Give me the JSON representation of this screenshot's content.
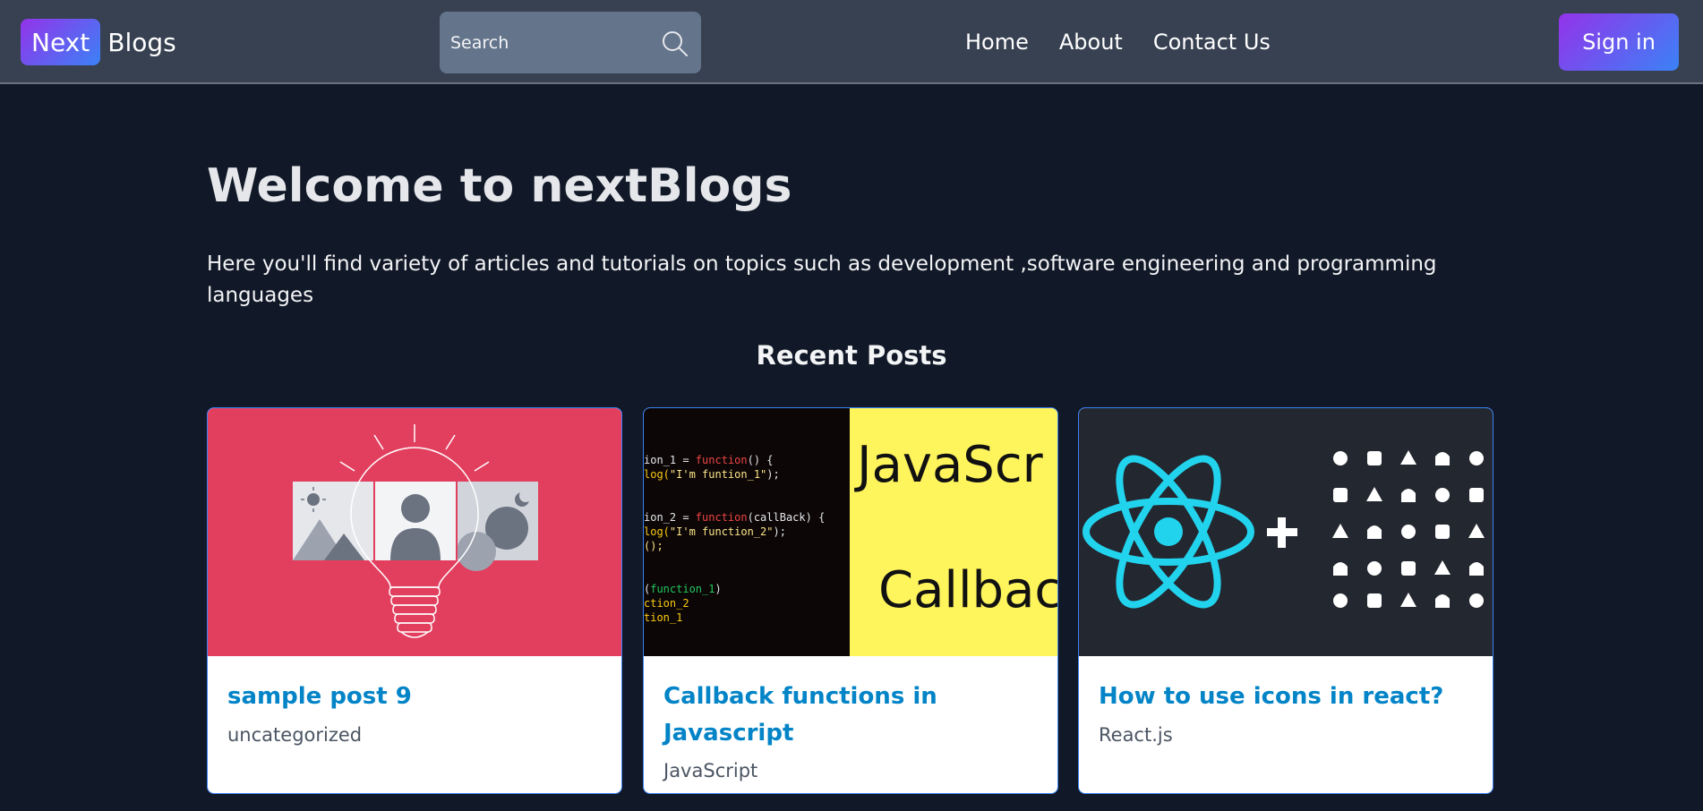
{
  "navbar": {
    "brand_badge": "Next",
    "brand_text": "Blogs",
    "search": {
      "placeholder": "Search",
      "value": ""
    },
    "links": [
      "Home",
      "About",
      "Contact Us"
    ],
    "signin_label": "Sign in"
  },
  "hero": {
    "title": "Welcome to nextBlogs",
    "description": "Here you'll find variety of articles and tutorials on topics such as development ,software engineering and programming languages"
  },
  "recent": {
    "heading": "Recent Posts",
    "posts": [
      {
        "title": "sample post 9",
        "category": "uncategorized",
        "image_icon": "lightbulb-illustration"
      },
      {
        "title": "Callback functions in Javascript",
        "category": "JavaScript",
        "image_icon": "javascript-code-illustration"
      },
      {
        "title": "How to use icons in react?",
        "category": "React.js",
        "image_icon": "react-icons-illustration"
      }
    ]
  },
  "code_image": {
    "lines": [
      [
        {
          "t": "ion_1 = ",
          "c": "#e5e7eb"
        },
        {
          "t": "function",
          "c": "#ef4444"
        },
        {
          "t": "() {",
          "c": "#e5e7eb"
        }
      ],
      [
        {
          "t": "log(",
          "c": "#facc15"
        },
        {
          "t": "\"I'm funtion_1\"",
          "c": "#fde68a"
        },
        {
          "t": ");",
          "c": "#e5e7eb"
        }
      ],
      [],
      [],
      [
        {
          "t": "ion_2 = ",
          "c": "#e5e7eb"
        },
        {
          "t": "function",
          "c": "#ef4444"
        },
        {
          "t": "(callBack) {",
          "c": "#e5e7eb"
        }
      ],
      [
        {
          "t": "log(",
          "c": "#facc15"
        },
        {
          "t": "\"I'm function_2\"",
          "c": "#fde68a"
        },
        {
          "t": ");",
          "c": "#e5e7eb"
        }
      ],
      [
        {
          "t": "();",
          "c": "#fde68a"
        }
      ],
      [],
      [],
      [
        {
          "t": "(",
          "c": "#e5e7eb"
        },
        {
          "t": "function_1",
          "c": "#22c55e"
        },
        {
          "t": ")",
          "c": "#e5e7eb"
        }
      ],
      [
        {
          "t": "ction_2",
          "c": "#facc15"
        }
      ],
      [
        {
          "t": "tion_1",
          "c": "#facc15"
        }
      ]
    ],
    "big_word_1": "JavaScr",
    "big_word_2": "Callbac"
  },
  "colors": {
    "background": "#111827",
    "navbar": "#374151",
    "accent_gradient_start": "#9333ea",
    "accent_gradient_end": "#3b82f6",
    "card_title": "#0284c7",
    "card1_image_bg": "#e23f5f",
    "card3_image_bg": "#23272f",
    "react_blue": "#22d3ee"
  }
}
